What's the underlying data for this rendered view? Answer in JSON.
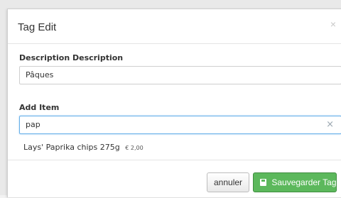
{
  "modal": {
    "title": "Tag Edit",
    "close_glyph": "×"
  },
  "description": {
    "label": "Description Description",
    "value": "Pâques"
  },
  "add_item": {
    "label": "Add Item",
    "value": "pap",
    "clear_glyph": "×"
  },
  "results": [
    {
      "name": "Lays' Paprika chips 275g",
      "price": "€ 2,00"
    }
  ],
  "footer": {
    "cancel_label": "annuler",
    "save_label": "Sauvegarder Tag",
    "save_icon": "floppy-disk-icon"
  },
  "colors": {
    "save_button": "#5cb85c",
    "focus_border": "#66afe9"
  }
}
